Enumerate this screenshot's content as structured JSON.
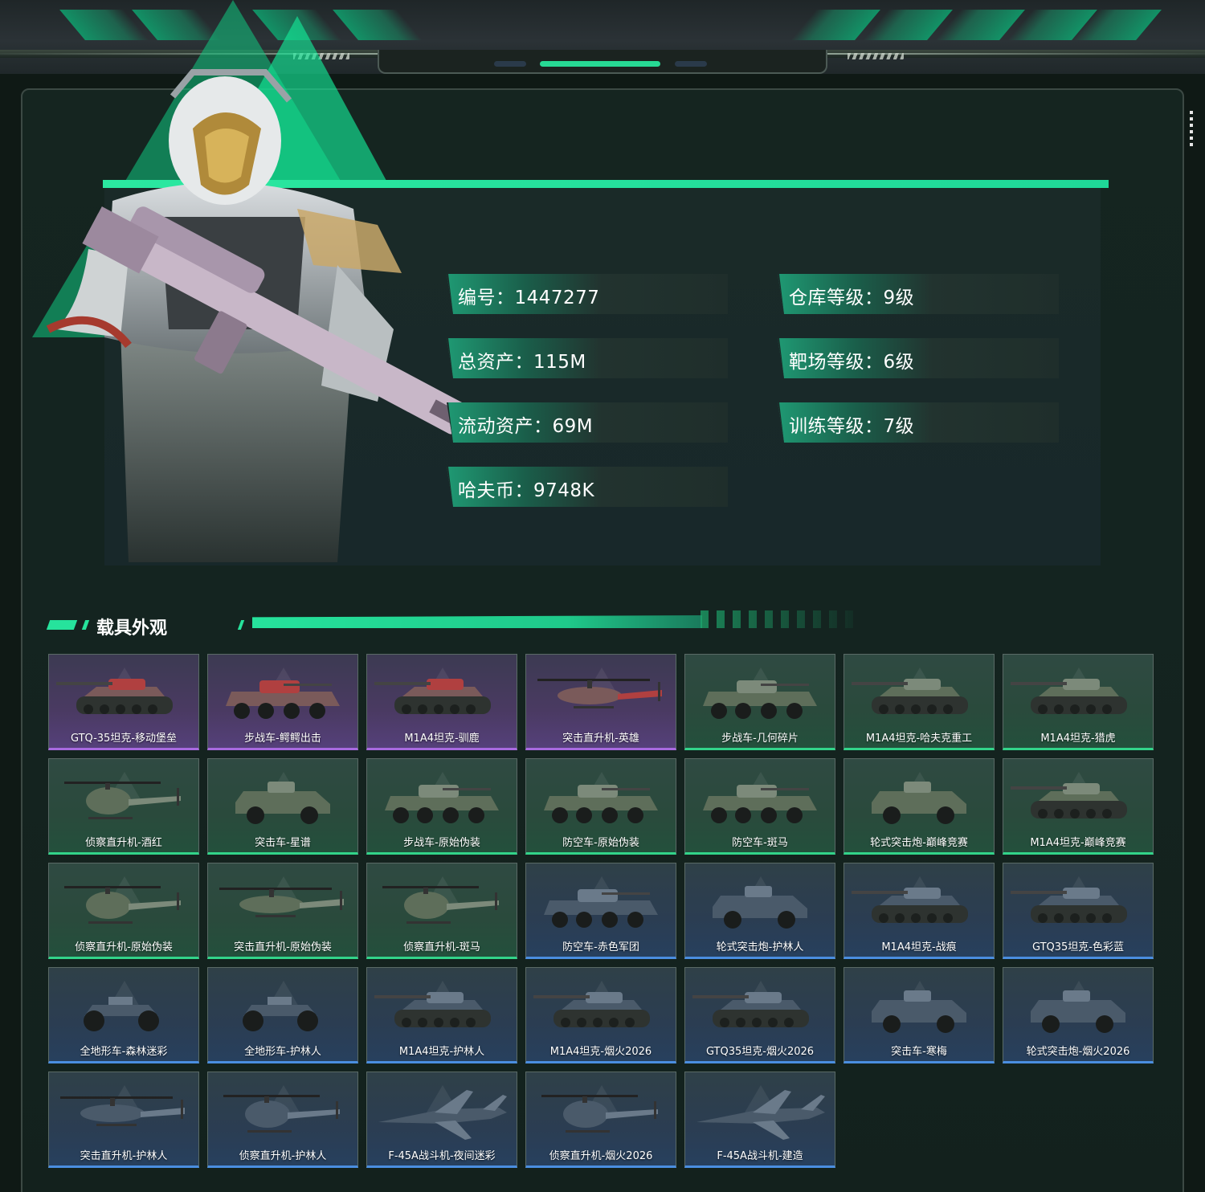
{
  "stats": [
    {
      "label": "编号：1447277"
    },
    {
      "label": "仓库等级：9级"
    },
    {
      "label": "总资产：115M"
    },
    {
      "label": "靶场等级：6级"
    },
    {
      "label": "流动资产：69M"
    },
    {
      "label": "训练等级：7级"
    },
    {
      "label": "哈夫币：9748K"
    }
  ],
  "section": {
    "title": "载具外观"
  },
  "colors": {
    "accent": "#26e39c",
    "rarity_purple": "#a86ae0",
    "rarity_green": "#32d48a",
    "rarity_blue": "#4a8ee0"
  },
  "vehicles": [
    {
      "name": "GTQ-35坦克-移动堡垒",
      "rarity": "purple",
      "kind": "tank-icon"
    },
    {
      "name": "步战车-鳄鳄出击",
      "rarity": "purple",
      "kind": "apc-icon"
    },
    {
      "name": "M1A4坦克-驯鹿",
      "rarity": "purple",
      "kind": "tank-icon"
    },
    {
      "name": "突击直升机-英雄",
      "rarity": "purple",
      "kind": "helicopter-icon"
    },
    {
      "name": "步战车-几何碎片",
      "rarity": "green",
      "kind": "apc-icon"
    },
    {
      "name": "M1A4坦克-哈夫克重工",
      "rarity": "green",
      "kind": "tank-icon"
    },
    {
      "name": "M1A4坦克-猎虎",
      "rarity": "green",
      "kind": "tank-icon"
    },
    {
      "name": "侦察直升机-酒红",
      "rarity": "green",
      "kind": "light-helicopter-icon"
    },
    {
      "name": "突击车-星谱",
      "rarity": "green",
      "kind": "armored-car-icon"
    },
    {
      "name": "步战车-原始伪装",
      "rarity": "green",
      "kind": "apc-icon"
    },
    {
      "name": "防空车-原始伪装",
      "rarity": "green",
      "kind": "apc-icon"
    },
    {
      "name": "防空车-斑马",
      "rarity": "green",
      "kind": "apc-icon"
    },
    {
      "name": "轮式突击炮-巅峰竞赛",
      "rarity": "green",
      "kind": "armored-car-icon"
    },
    {
      "name": "M1A4坦克-巅峰竞赛",
      "rarity": "green",
      "kind": "tank-icon"
    },
    {
      "name": "侦察直升机-原始伪装",
      "rarity": "green",
      "kind": "light-helicopter-icon"
    },
    {
      "name": "突击直升机-原始伪装",
      "rarity": "green",
      "kind": "helicopter-icon"
    },
    {
      "name": "侦察直升机-斑马",
      "rarity": "green",
      "kind": "light-helicopter-icon"
    },
    {
      "name": "防空车-赤色军团",
      "rarity": "blue",
      "kind": "apc-icon"
    },
    {
      "name": "轮式突击炮-护林人",
      "rarity": "blue",
      "kind": "armored-car-icon"
    },
    {
      "name": "M1A4坦克-战痕",
      "rarity": "blue",
      "kind": "tank-icon"
    },
    {
      "name": "GTQ35坦克-色彩蓝",
      "rarity": "blue",
      "kind": "tank-icon"
    },
    {
      "name": "全地形车-森林迷彩",
      "rarity": "blue",
      "kind": "atv-icon"
    },
    {
      "name": "全地形车-护林人",
      "rarity": "blue",
      "kind": "atv-icon"
    },
    {
      "name": "M1A4坦克-护林人",
      "rarity": "blue",
      "kind": "tank-icon"
    },
    {
      "name": "M1A4坦克-烟火2026",
      "rarity": "blue",
      "kind": "tank-icon"
    },
    {
      "name": "GTQ35坦克-烟火2026",
      "rarity": "blue",
      "kind": "tank-icon"
    },
    {
      "name": "突击车-寒梅",
      "rarity": "blue",
      "kind": "armored-car-icon"
    },
    {
      "name": "轮式突击炮-烟火2026",
      "rarity": "blue",
      "kind": "armored-car-icon"
    },
    {
      "name": "突击直升机-护林人",
      "rarity": "blue",
      "kind": "helicopter-icon"
    },
    {
      "name": "侦察直升机-护林人",
      "rarity": "blue",
      "kind": "light-helicopter-icon"
    },
    {
      "name": "F-45A战斗机-夜间迷彩",
      "rarity": "blue",
      "kind": "jet-icon"
    },
    {
      "name": "侦察直升机-烟火2026",
      "rarity": "blue",
      "kind": "light-helicopter-icon"
    },
    {
      "name": "F-45A战斗机-建造",
      "rarity": "blue",
      "kind": "jet-icon"
    }
  ]
}
